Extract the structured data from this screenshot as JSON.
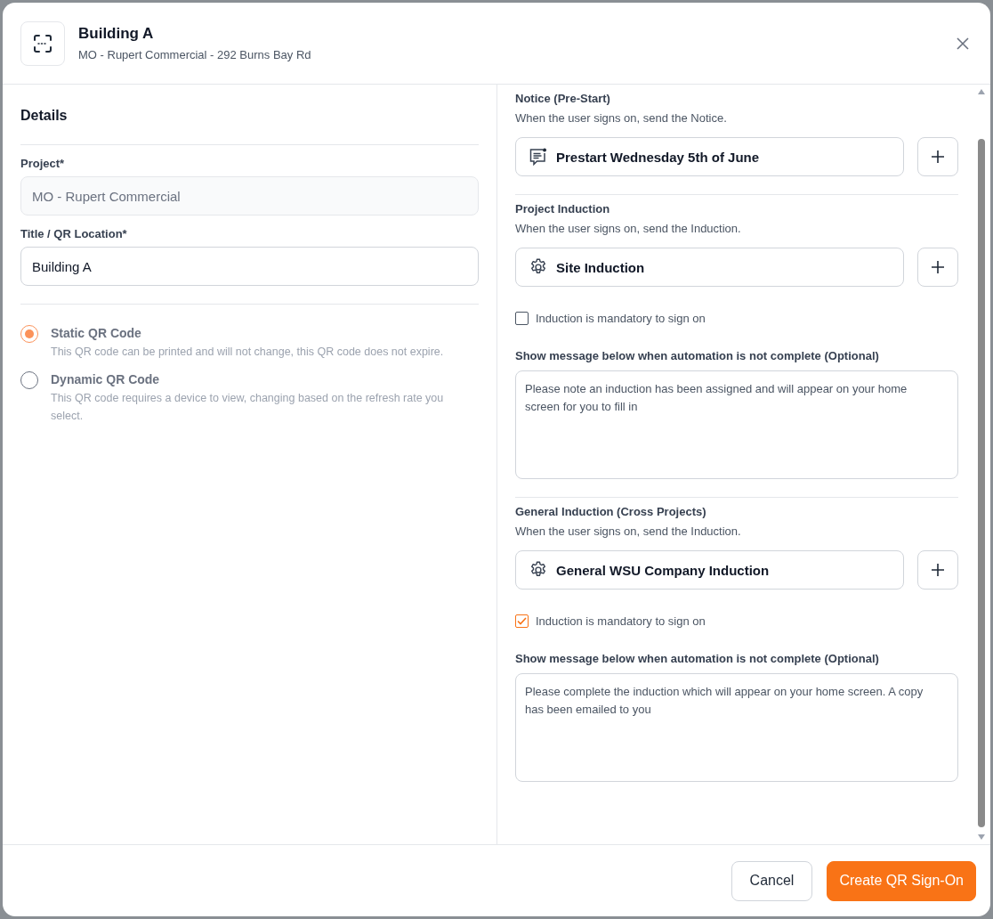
{
  "header": {
    "title": "Building A",
    "subtitle": "MO - Rupert Commercial - 292 Burns Bay Rd"
  },
  "details": {
    "heading": "Details",
    "fields": [
      {
        "label": "Project*",
        "value": "MO - Rupert Commercial",
        "disabled": true
      },
      {
        "label": "Title / QR Location*",
        "value": "Building A",
        "disabled": false
      }
    ],
    "qr_types": [
      {
        "label": "Static QR Code",
        "description": "This QR code can be printed and will not change, this QR code does not expire.",
        "selected": true
      },
      {
        "label": "Dynamic QR Code",
        "description": "This QR code requires a device to view, changing based on the refresh rate you select.",
        "selected": false
      }
    ]
  },
  "automations": [
    {
      "kind": "notice",
      "title": "Notice (Pre-Start)",
      "description": "When the user signs on, send the Notice.",
      "item": "Prestart Wednesday 5th of June"
    },
    {
      "kind": "induction",
      "title": "Project Induction",
      "description": "When the user signs on, send the Induction.",
      "item": "Site Induction",
      "mandatory": {
        "label": "Induction is mandatory to sign on",
        "checked": false
      },
      "message_label": "Show message below when automation is not complete (Optional)",
      "message": "Please note an induction has been assigned and will appear on your home screen for you to fill in"
    },
    {
      "kind": "induction",
      "title": "General Induction (Cross Projects)",
      "description": "When the user signs on, send the Induction.",
      "item": "General WSU Company Induction",
      "mandatory": {
        "label": "Induction is mandatory to sign on",
        "checked": true
      },
      "message_label": "Show message below when automation is not complete (Optional)",
      "message": "Please complete the induction which will appear on your home screen. A copy has been emailed to you"
    }
  ],
  "footer": {
    "buttons": [
      {
        "label": "Cancel",
        "kind": "secondary"
      },
      {
        "label": "Create QR Sign-On",
        "kind": "primary"
      }
    ]
  }
}
